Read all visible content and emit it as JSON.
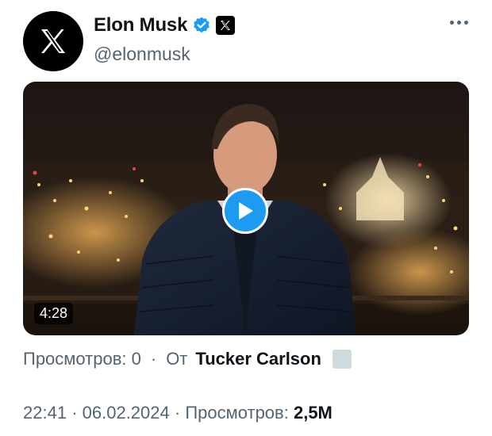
{
  "author": {
    "name": "Elon Musk",
    "handle": "@elonmusk",
    "avatar_icon": "x-logo-icon",
    "verified_icon": "verified-badge-icon",
    "affiliation_icon": "x-affiliate-icon"
  },
  "media": {
    "duration": "4:28",
    "play_icon": "play-icon"
  },
  "attribution": {
    "views_text": "Просмотров: 0",
    "separator": "·",
    "from_label": "От",
    "source_name": "Tucker Carlson"
  },
  "meta": {
    "time": "22:41",
    "sep1": "·",
    "date": "06.02.2024",
    "sep2": "·",
    "views_label": "Просмотров:",
    "views_count": "2,5M"
  },
  "colors": {
    "accent": "#1d9bf0",
    "text_primary": "#0f1419",
    "text_secondary": "#536471"
  }
}
